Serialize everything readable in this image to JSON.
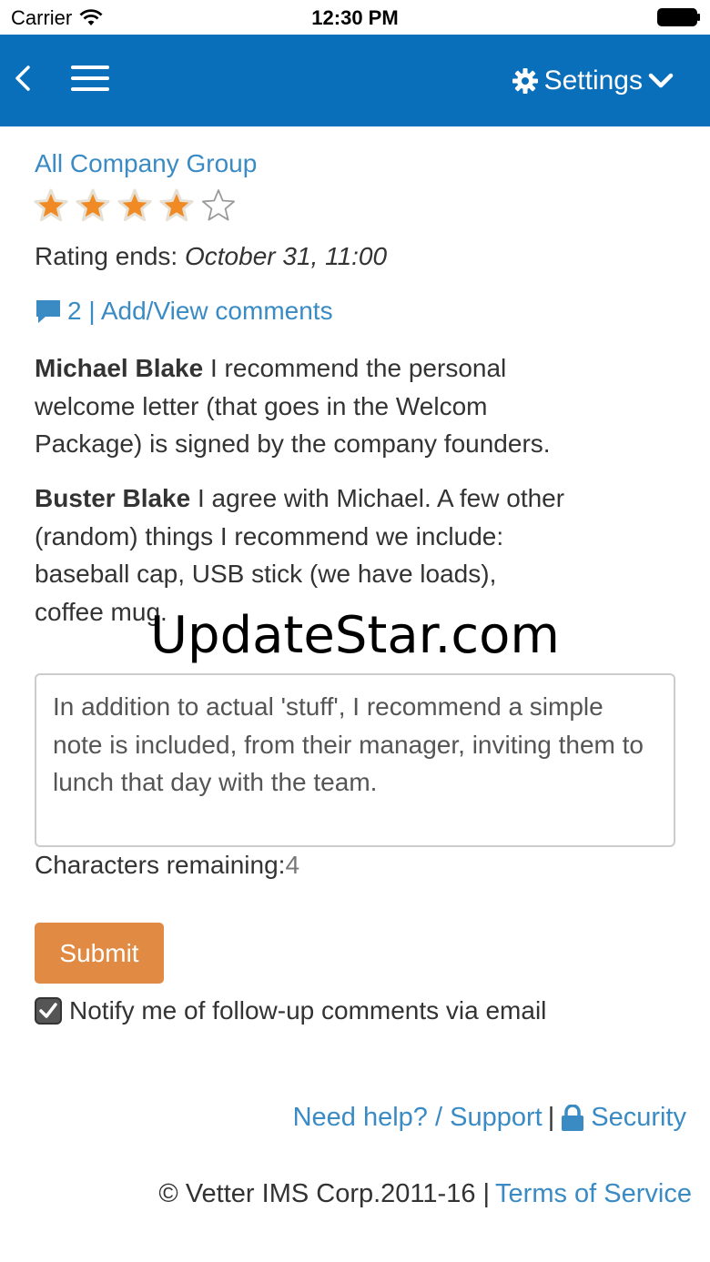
{
  "status_bar": {
    "carrier": "Carrier",
    "time": "12:30 PM"
  },
  "navbar": {
    "settings_label": "Settings",
    "icons": [
      "back-chevron-icon",
      "hamburger-menu-icon",
      "gear-icon",
      "chevron-down-icon"
    ],
    "background_color": "#0a6fba"
  },
  "group": {
    "title": "All Company Group",
    "rating": 4,
    "rating_max": 5,
    "rating_ends_label": "Rating ends:",
    "rating_ends_value": "October 31, 11:00"
  },
  "comments": {
    "link_text": "2 | Add/View comments",
    "items": [
      {
        "author": "Michael Blake",
        "text": " I recommend the personal welcome letter (that goes in the Welcom Package) is signed by the company founders."
      },
      {
        "author": "Buster Blake",
        "text": " I agree with Michael. A few other (random) things I recommend we include: baseball cap, USB stick (we have loads), coffee mug."
      }
    ]
  },
  "watermark": "UpdateStar.com",
  "compose": {
    "value": "In addition to actual 'stuff', I recommend a simple note is included, from their manager, inviting them to lunch that day with the team.",
    "chars_label": "Characters remaining:",
    "chars_remaining": "4",
    "submit_label": "Submit",
    "notify_label": "Notify me of follow-up comments via email",
    "notify_checked": true
  },
  "footer": {
    "help_link": "Need help? / Support",
    "separator": "|",
    "security_link": "Security",
    "copyright": "© Vetter IMS Corp.2011-16 |",
    "terms_link": "Terms of Service"
  },
  "colors": {
    "link": "#3a8bc4",
    "submit": "#e08a44",
    "star_fill": "#f08a24"
  }
}
